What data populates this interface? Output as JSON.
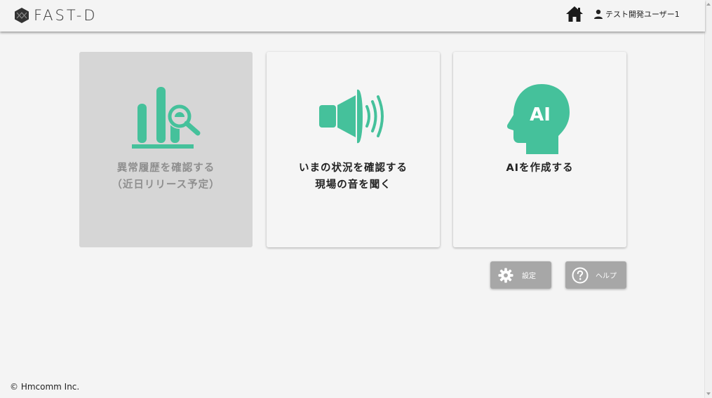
{
  "header": {
    "logo_text": "FAST-D",
    "logo_icon": "hexagon-logo-icon",
    "home_icon": "home-icon",
    "user_icon": "person-icon",
    "user_name": "テスト開発ユーザー1"
  },
  "cards": [
    {
      "icon": "chart-search-icon",
      "line1": "異常履歴を確認する",
      "line2": "（近日リリース予定）",
      "disabled": true
    },
    {
      "icon": "speaker-icon",
      "line1": "いまの状況を確認する",
      "line2": "現場の音を聞く",
      "disabled": false
    },
    {
      "icon": "ai-head-icon",
      "icon_text": "AI",
      "line1": "AIを作成する",
      "disabled": false
    }
  ],
  "buttons": {
    "settings_label": "設定",
    "settings_icon": "gear-icon",
    "help_label": "ヘルプ",
    "help_icon": "question-circle-icon"
  },
  "footer": {
    "copyright": "© Hmcomm Inc."
  },
  "colors": {
    "accent": "#45c19b",
    "disabled_card": "#d6d6d6",
    "small_button": "#a7a7a7",
    "background": "#f4f4f4"
  }
}
